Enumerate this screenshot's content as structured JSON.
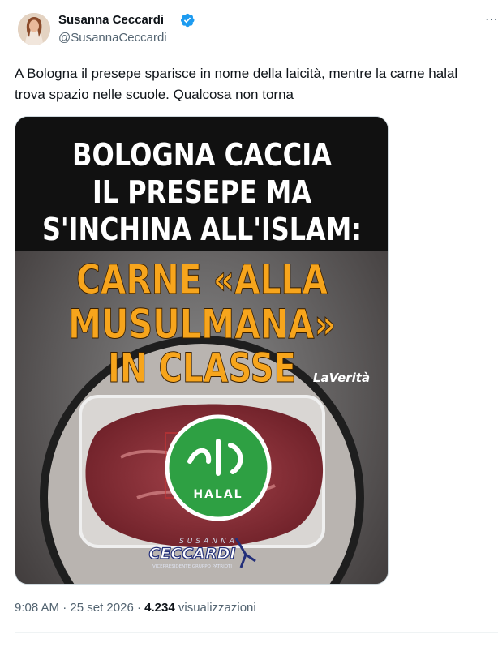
{
  "author": {
    "name": "Susanna Ceccardi",
    "handle": "@SusannaCeccardi",
    "verified": true,
    "avatar_icon": "profile-photo"
  },
  "tweet": {
    "text_line1": "A Bologna il presepe sparisce in nome della laicità, mentre la carne halal",
    "text_line2": "trova spazio nelle scuole. Qualcosa non torna"
  },
  "image": {
    "headline_lines": [
      "BOLOGNA CACCIA",
      "IL PRESEPE MA",
      "S'INCHINA ALL'ISLAM:"
    ],
    "subhead_lines": [
      "CARNE «ALLA",
      "MUSULMANA»",
      "IN CLASSE"
    ],
    "source_logo": "LaVerità",
    "badge_text": "HALAL",
    "signature_top": "SUSANNA",
    "signature_name": "CECCARDI",
    "signature_sub": "VICEPRESIDENTE GRUPPO PATRIOTI",
    "colors": {
      "headline": "#ffffff",
      "subhead": "#f7a51c",
      "badge": "#2ea043",
      "top_band": "#111111"
    }
  },
  "meta": {
    "time": "9:08 AM",
    "separator": " · ",
    "date": "25 set 2026",
    "views_count": "4.234",
    "views_label": "visualizzazioni"
  }
}
